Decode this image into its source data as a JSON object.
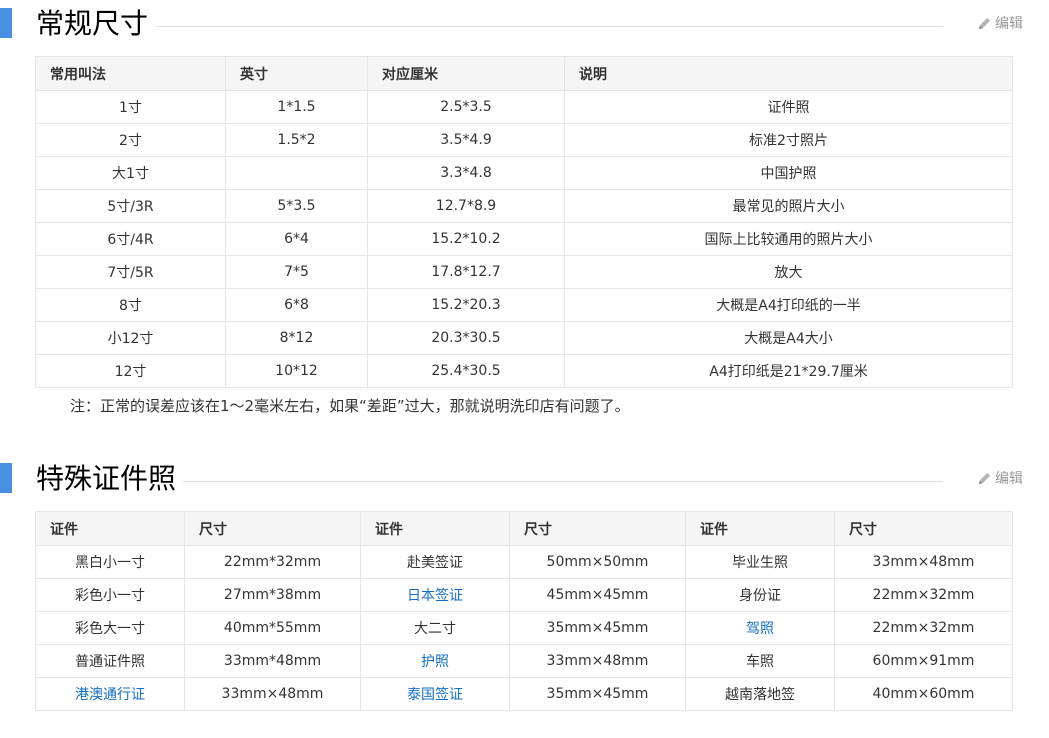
{
  "section1": {
    "title": "常规尺寸",
    "edit_label": "编辑",
    "headers": [
      "常用叫法",
      "英寸",
      "对应厘米",
      "说明"
    ],
    "rows": [
      [
        "1寸",
        "1*1.5",
        "2.5*3.5",
        "证件照"
      ],
      [
        "2寸",
        "1.5*2",
        "3.5*4.9",
        "标准2寸照片"
      ],
      [
        "大1寸",
        "",
        "3.3*4.8",
        "中国护照"
      ],
      [
        "5寸/3R",
        "5*3.5",
        "12.7*8.9",
        "最常见的照片大小"
      ],
      [
        "6寸/4R",
        "6*4",
        "15.2*10.2",
        "国际上比较通用的照片大小"
      ],
      [
        "7寸/5R",
        "7*5",
        "17.8*12.7",
        "放大"
      ],
      [
        "8寸",
        "6*8",
        "15.2*20.3",
        "大概是A4打印纸的一半"
      ],
      [
        "小12寸",
        "8*12",
        "20.3*30.5",
        "大概是A4大小"
      ],
      [
        "12寸",
        "10*12",
        "25.4*30.5",
        "A4打印纸是21*29.7厘米"
      ]
    ],
    "note": "注：正常的误差应该在1～2毫米左右，如果“差距”过大，那就说明洗印店有问题了。"
  },
  "section2": {
    "title": "特殊证件照",
    "edit_label": "编辑",
    "headers": [
      "证件",
      "尺寸",
      "证件",
      "尺寸",
      "证件",
      "尺寸"
    ],
    "rows": [
      [
        "黑白小一寸",
        "22mm*32mm",
        "赴美签证",
        "50mm×50mm",
        "毕业生照",
        "33mm×48mm"
      ],
      [
        "彩色小一寸",
        "27mm*38mm",
        "日本签证",
        "45mm×45mm",
        "身份证",
        "22mm×32mm"
      ],
      [
        "彩色大一寸",
        "40mm*55mm",
        "大二寸",
        "35mm×45mm",
        "驾照",
        "22mm×32mm"
      ],
      [
        "普通证件照",
        "33mm*48mm",
        "护照",
        "33mm×48mm",
        "车照",
        "60mm×91mm"
      ],
      [
        "港澳通行证",
        "33mm×48mm",
        "泰国签证",
        "35mm×45mm",
        "越南落地签",
        "40mm×60mm"
      ]
    ],
    "links": [
      [
        0,
        0,
        0,
        0,
        0,
        0
      ],
      [
        0,
        0,
        1,
        0,
        0,
        0
      ],
      [
        0,
        0,
        0,
        0,
        1,
        0
      ],
      [
        0,
        0,
        1,
        0,
        0,
        0
      ],
      [
        1,
        0,
        1,
        0,
        0,
        0
      ]
    ],
    "link_color": "#136ec2"
  },
  "accent_color": "#4a90e2"
}
